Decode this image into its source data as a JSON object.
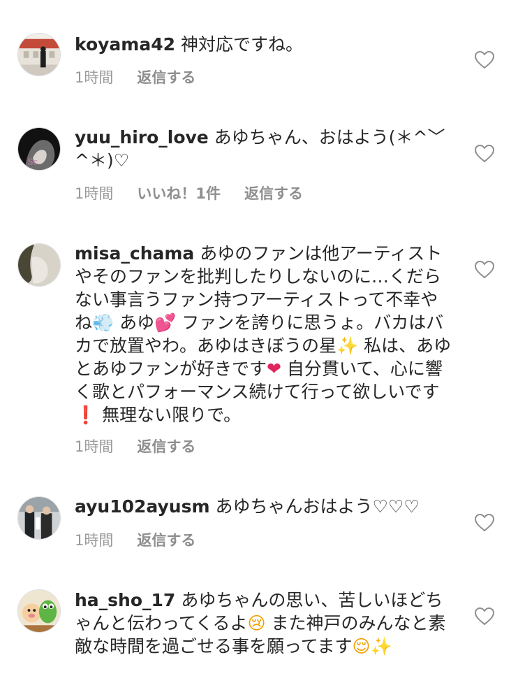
{
  "comments": [
    {
      "avatar_icon": "user-avatar-koyama42",
      "username": "koyama42",
      "text": "神対応ですね。",
      "time": "1時間",
      "likes": "",
      "reply": "返信する"
    },
    {
      "avatar_icon": "user-avatar-yuu-hiro-love",
      "username": "yuu_hiro_love",
      "text": "あゆちゃん、おはよう(＊^﹀^＊)♡",
      "time": "1時間",
      "likes": "いいね！1件",
      "reply": "返信する"
    },
    {
      "avatar_icon": "user-avatar-misa-chama",
      "username": "misa_chama",
      "text_parts": [
        "あゆのファンは他アーティストやそのファンを批判したりしないのに…くだらない事言うファン持つアーティストって不幸やね",
        "💨",
        " あゆ",
        "💕",
        " ファンを誇りに思うょ。バカはバカで放置やわ。あゆはきぼうの星",
        "✨",
        " 私は、あゆとあゆファンが好きです",
        "❤",
        " 自分貫いて、心に響く歌とパフォーマンス続けて行って欲しいです",
        "❗",
        " 無理ない限りで。"
      ],
      "time": "1時間",
      "likes": "",
      "reply": "返信する"
    },
    {
      "avatar_icon": "user-avatar-ayu102ayusm",
      "username": "ayu102ayusm",
      "text": "あゆちゃんおはよう♡♡♡",
      "time": "1時間",
      "likes": "",
      "reply": "返信する"
    },
    {
      "avatar_icon": "user-avatar-ha-sho-17",
      "username": "ha_sho_17",
      "text_parts": [
        "あゆちゃんの思い、苦しいほどちゃんと伝わってくるよ",
        "😢",
        " また神戸のみんなと素敵な時間を過ごせる事を願ってます",
        "😌",
        "✨"
      ],
      "time": "",
      "likes": "",
      "reply": ""
    }
  ],
  "like_icon": "heart-outline-icon",
  "colors": {
    "text": "#262626",
    "meta": "#999999",
    "icon": "#8e8e8e",
    "background": "#ffffff"
  }
}
